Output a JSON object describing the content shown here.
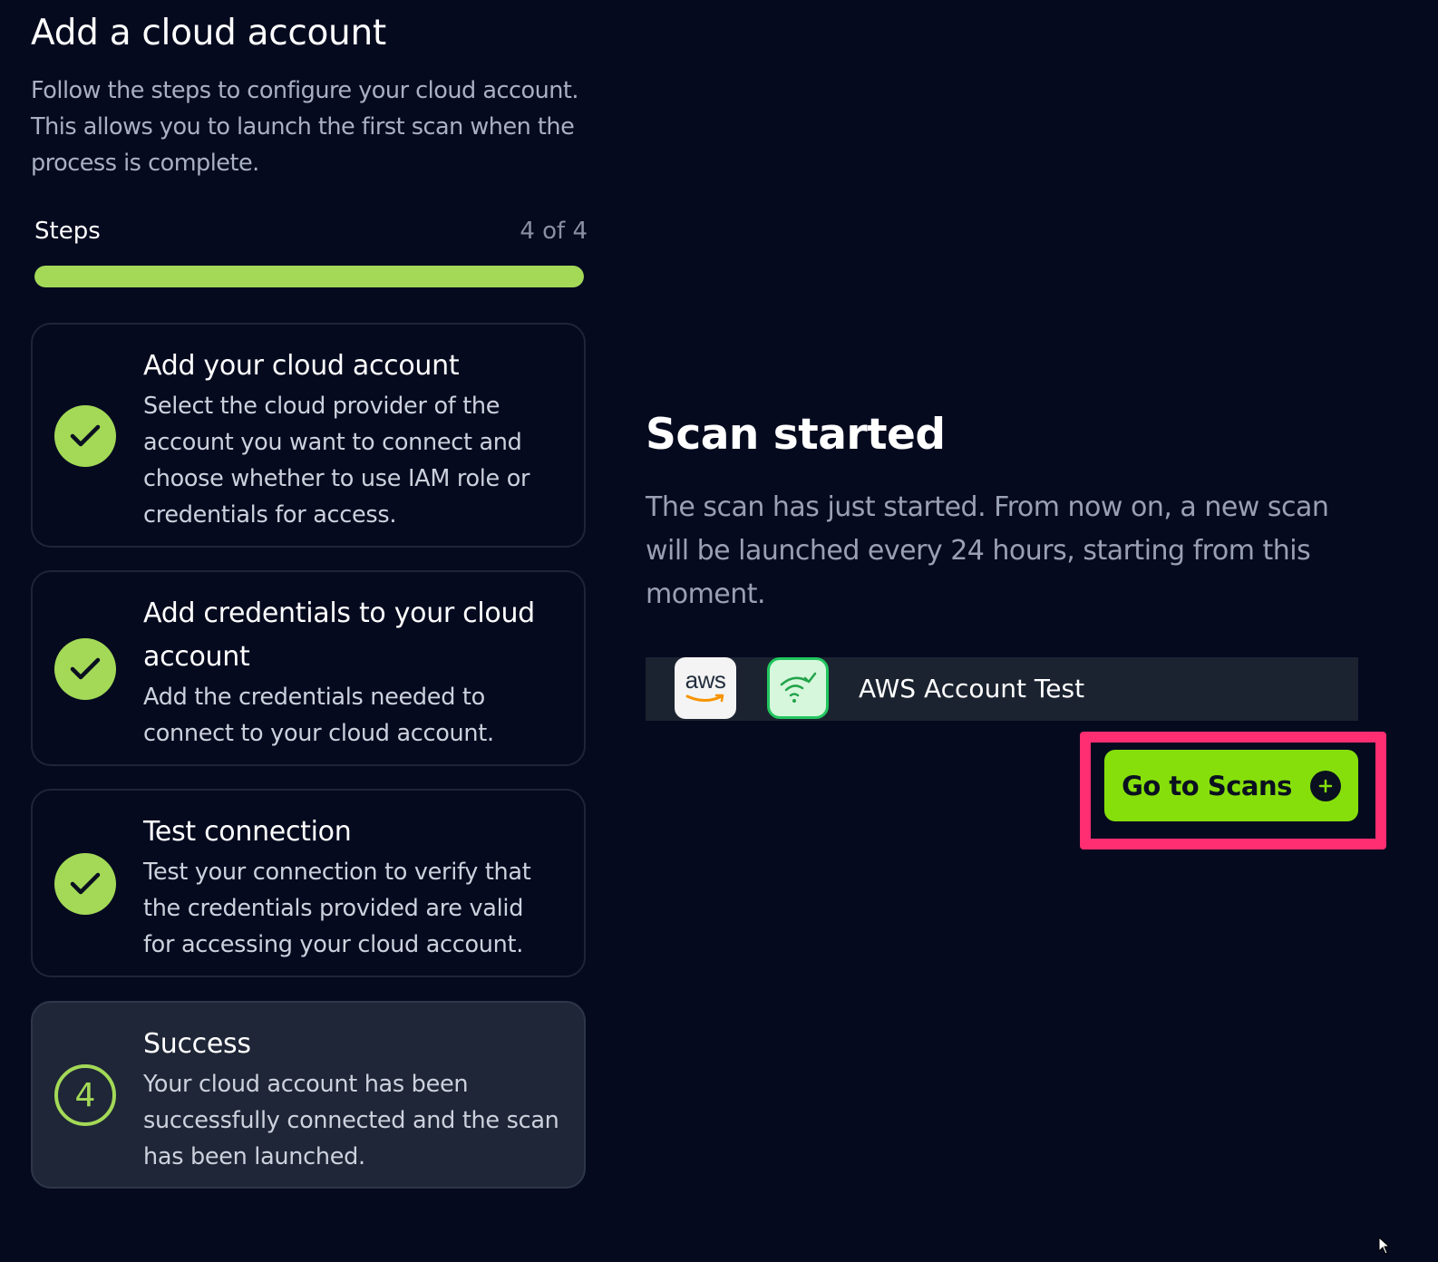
{
  "header": {
    "title": "Add a cloud account",
    "subtitle": "Follow the steps to configure your cloud account. This allows you to launch the first scan when the process is complete."
  },
  "progress": {
    "label": "Steps",
    "count_text": "4 of 4",
    "fraction": 1.0,
    "color": "#a3d957"
  },
  "steps": [
    {
      "title": "Add your cloud account",
      "description": "Select the cloud provider of the account you want to connect and choose whether to use IAM role or credentials for access.",
      "status": "completed",
      "icon": "check-icon"
    },
    {
      "title": "Add credentials to your cloud account",
      "description": "Add the credentials needed to connect to your cloud account.",
      "status": "completed",
      "icon": "check-icon"
    },
    {
      "title": "Test connection",
      "description": "Test your connection to verify that the credentials provided are valid for accessing your cloud account.",
      "status": "completed",
      "icon": "check-icon"
    },
    {
      "title": "Success",
      "description": "Your cloud account has been successfully connected and the scan has been launched.",
      "status": "current",
      "number": "4"
    }
  ],
  "scan": {
    "title": "Scan started",
    "description": "The scan has just started. From now on, a new scan will be launched every 24 hours, starting from this moment."
  },
  "account": {
    "provider_logo_text": "aws",
    "provider_icon": "aws-logo-icon",
    "status_icon": "wifi-check-icon",
    "name": "AWS Account Test"
  },
  "actions": {
    "go_to_scans_label": "Go to Scans",
    "go_to_scans_icon": "plus-circle-icon"
  },
  "colors": {
    "background": "#050a1f",
    "accent": "#a3d957",
    "button": "#86df0b",
    "highlight": "#ff2d72"
  }
}
